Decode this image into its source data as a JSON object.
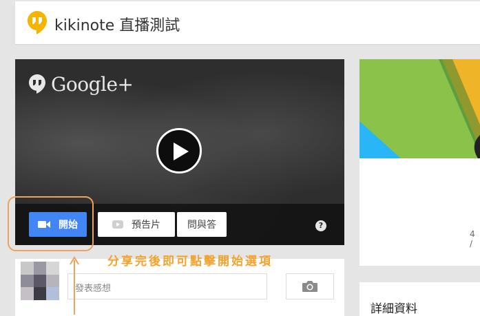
{
  "header": {
    "title": "kikinote 直播測試",
    "icon": "hangouts-icon",
    "icon_color": "#f4b400"
  },
  "video": {
    "brand": "Google+",
    "controls": {
      "start_label": "開始",
      "trailer_label": "預告片",
      "qa_label": "問與答",
      "help_label": "?",
      "start_color": "#4285f4"
    }
  },
  "annotation": {
    "text": "分享完後即可點擊開始選項",
    "color": "#f5a22c"
  },
  "comment": {
    "placeholder": "發表感想"
  },
  "side": {
    "count_text": "4 /"
  },
  "details": {
    "title": "詳細資料"
  }
}
